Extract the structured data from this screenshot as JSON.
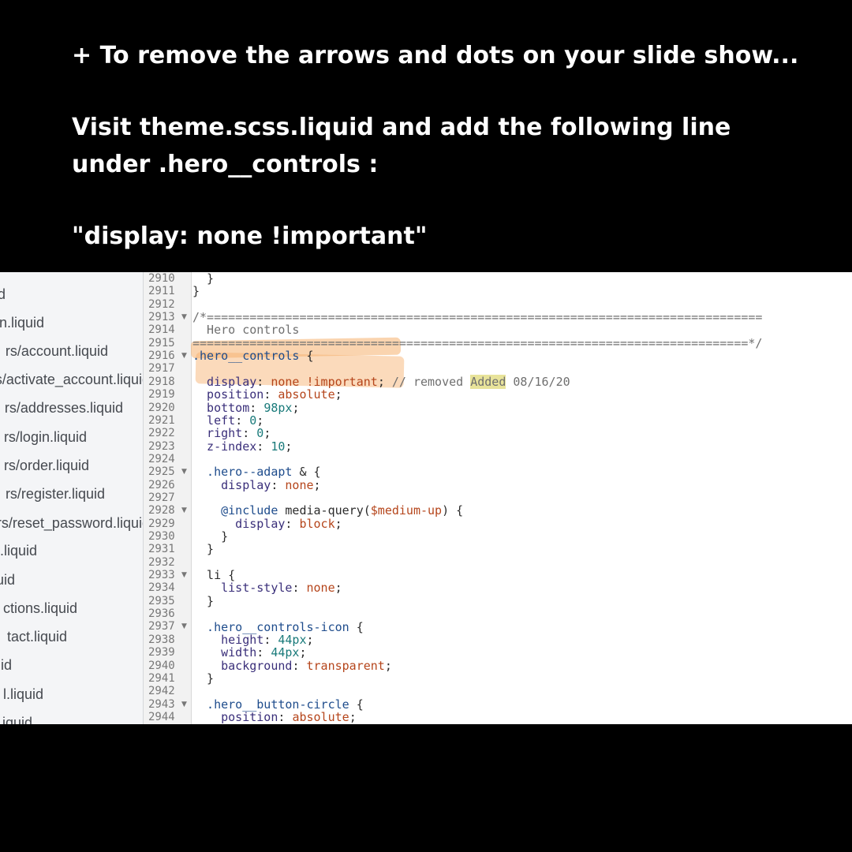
{
  "instructions": {
    "line1": "+ To remove the arrows and dots on your slide show...",
    "line2": "Visit theme.scss.liquid and add the following line",
    "line3": "under .hero__controls :",
    "line4": "\"display: none !important\""
  },
  "file_list": [
    "d",
    "n.liquid",
    "rs/account.liquid",
    "rs/activate_account.liquid",
    "rs/addresses.liquid",
    "rs/login.liquid",
    "rs/order.liquid",
    "rs/register.liquid",
    "rs/reset_password.liquid",
    ".liquid",
    "uid",
    "ctions.liquid",
    "tact.liquid",
    "id",
    "l.liquid",
    "iquid"
  ],
  "line_numbers": [
    "2910",
    "2911",
    "2912",
    "2913",
    "2914",
    "2915",
    "2916",
    "2917",
    "2918",
    "2919",
    "2920",
    "2921",
    "2922",
    "2923",
    "2924",
    "2925",
    "2926",
    "2927",
    "2928",
    "2929",
    "2930",
    "2931",
    "2932",
    "2933",
    "2934",
    "2935",
    "2936",
    "2937",
    "2938",
    "2939",
    "2940",
    "2941",
    "2942",
    "2943",
    "2944"
  ],
  "code": {
    "l2910": "  }",
    "l2911": "}",
    "l2913": "/*==============================================================================",
    "l2914": "  Hero controls",
    "l2915": "==============================================================================*/",
    "l2916_sel": ".hero__controls",
    "l2916_brace": " {",
    "l2918_prop": "  display",
    "l2918_colon": ": ",
    "l2918_val": "none !important",
    "l2918_semi": "; ",
    "l2918_cmt1": "// removed ",
    "l2918_added": "Added",
    "l2918_cmt2": " 08/16/20",
    "l2919_prop": "  position",
    "l2919_val": "absolute",
    "l2920_prop": "  bottom",
    "l2920_val": "98px",
    "l2921_prop": "  left",
    "l2921_val": "0",
    "l2922_prop": "  right",
    "l2922_val": "0",
    "l2923_prop": "  z-index",
    "l2923_val": "10",
    "l2925_sel": "  .hero--adapt",
    "l2925_rest": " & {",
    "l2926_prop": "    display",
    "l2926_val": "none",
    "l2928_at": "    @include",
    "l2928_fn": " media-query(",
    "l2928_var": "$medium-up",
    "l2928_rest": ") {",
    "l2929_prop": "      display",
    "l2929_val": "block",
    "l2930": "    }",
    "l2931": "  }",
    "l2933": "  li {",
    "l2934_prop": "    list-style",
    "l2934_val": "none",
    "l2935": "  }",
    "l2937_sel": "  .hero__controls-icon",
    "l2937_brace": " {",
    "l2938_prop": "    height",
    "l2938_val": "44px",
    "l2939_prop": "    width",
    "l2939_val": "44px",
    "l2940_prop": "    background",
    "l2940_val": "transparent",
    "l2941": "  }",
    "l2943_sel": "  .hero__button-circle",
    "l2943_brace": " {",
    "l2944_prop": "    position",
    "l2944_val": "absolute"
  },
  "fold_lines": [
    "2913",
    "2916",
    "2925",
    "2928",
    "2933",
    "2937",
    "2943"
  ],
  "colors": {
    "page_bg": "#000000",
    "instruction_text": "#ffffff",
    "highlight_brush": "#f6b06e",
    "added_highlight": "#e8e39a"
  }
}
